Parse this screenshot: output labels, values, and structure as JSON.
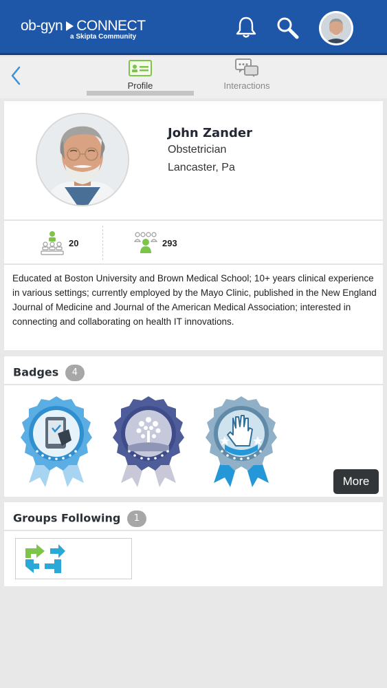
{
  "header": {
    "logo_main": "ob-gyn",
    "logo_connect": "CONNECT",
    "logo_sub": "a Skipta Community",
    "icons": [
      "bell-icon",
      "search-icon"
    ],
    "brand_color": "#1e57a8"
  },
  "tabs": [
    {
      "label": "Profile",
      "icon": "profile-card-icon",
      "active": true
    },
    {
      "label": "Interactions",
      "icon": "chat-bubbles-icon",
      "active": false
    }
  ],
  "profile": {
    "name": "John Zander",
    "role": "Obstetrician",
    "location": "Lancaster, Pa",
    "stats": {
      "following": "20",
      "followers": "293"
    },
    "bio": "Educated at Boston University and Brown Medical School; 10+ years clinical experience in various settings; currently employed by the Mayo Clinic, published in the New England Journal of Medicine and Journal of the American Medical Association; interested in connecting and collaborating on health IT innovations."
  },
  "badges": {
    "title": "Badges",
    "count": "4",
    "items": [
      "tablet-badge-icon",
      "tree-badge-icon",
      "hand-badge-icon"
    ],
    "more_label": "More"
  },
  "groups": {
    "title": "Groups Following",
    "count": "1",
    "items": [
      "group-logo-icon"
    ]
  }
}
